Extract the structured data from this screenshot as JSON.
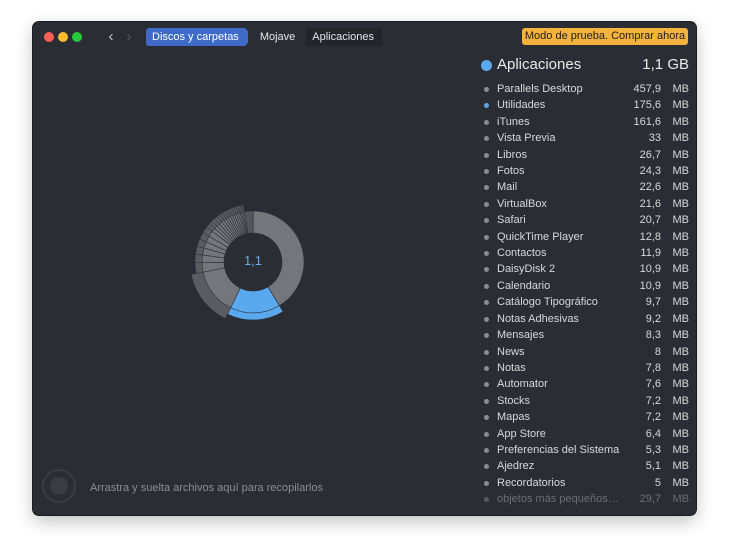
{
  "window": {
    "breadcrumbs": [
      "Discos y carpetas",
      "Mojave",
      "Aplicaciones"
    ],
    "trial_button": "Modo de prueba. Comprar ahora"
  },
  "chart": {
    "center_label": "1,1",
    "accent_color": "#5aa8ee"
  },
  "drop_zone": {
    "text": "Arrastra y suelta archivos aquí para recopilarlos"
  },
  "list": {
    "title": "Aplicaciones",
    "total": "1,1 GB",
    "items": [
      {
        "name": "Parallels Desktop",
        "value": "457,9",
        "unit": "MB"
      },
      {
        "name": "Utilidades",
        "value": "175,6",
        "unit": "MB",
        "highlight": true
      },
      {
        "name": "iTunes",
        "value": "161,6",
        "unit": "MB"
      },
      {
        "name": "Vista Previa",
        "value": "33",
        "unit": "MB"
      },
      {
        "name": "Libros",
        "value": "26,7",
        "unit": "MB"
      },
      {
        "name": "Fotos",
        "value": "24,3",
        "unit": "MB"
      },
      {
        "name": "Mail",
        "value": "22,6",
        "unit": "MB"
      },
      {
        "name": "VirtualBox",
        "value": "21,6",
        "unit": "MB"
      },
      {
        "name": "Safari",
        "value": "20,7",
        "unit": "MB"
      },
      {
        "name": "QuickTime Player",
        "value": "12,8",
        "unit": "MB"
      },
      {
        "name": "Contactos",
        "value": "11,9",
        "unit": "MB"
      },
      {
        "name": "DaisyDisk 2",
        "value": "10,9",
        "unit": "MB"
      },
      {
        "name": "Calendario",
        "value": "10,9",
        "unit": "MB"
      },
      {
        "name": "Catálogo Tipográfico",
        "value": "9,7",
        "unit": "MB"
      },
      {
        "name": "Notas Adhesivas",
        "value": "9,2",
        "unit": "MB"
      },
      {
        "name": "Mensajes",
        "value": "8,3",
        "unit": "MB"
      },
      {
        "name": "News",
        "value": "8",
        "unit": "MB"
      },
      {
        "name": "Notas",
        "value": "7,8",
        "unit": "MB"
      },
      {
        "name": "Automator",
        "value": "7,6",
        "unit": "MB"
      },
      {
        "name": "Stocks",
        "value": "7,2",
        "unit": "MB"
      },
      {
        "name": "Mapas",
        "value": "7,2",
        "unit": "MB"
      },
      {
        "name": "App Store",
        "value": "6,4",
        "unit": "MB"
      },
      {
        "name": "Preferencias del Sistema",
        "value": "5,3",
        "unit": "MB"
      },
      {
        "name": "Ajedrez",
        "value": "5,1",
        "unit": "MB"
      },
      {
        "name": "Recordatorios",
        "value": "5",
        "unit": "MB"
      },
      {
        "name": "objetos más pequeños…",
        "value": "29,7",
        "unit": "MB",
        "dim": true
      }
    ]
  }
}
